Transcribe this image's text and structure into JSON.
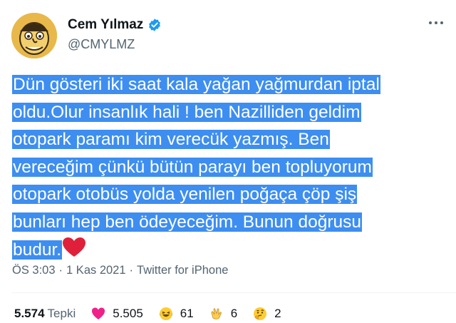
{
  "user": {
    "display_name": "Cem Yılmaz",
    "handle": "@CMYLMZ",
    "avatar_icon": "cartoon-face-avatar",
    "verified_color": "#1d9bf0"
  },
  "tweet": {
    "lines": [
      "Dün gösteri iki saat kala yağan yağmurdan iptal",
      "oldu.Olur insanlık hali ! ben Nazilliden geldim",
      "otopark paramı kim verecük yazmış. Ben",
      "vereceğim çünkü bütün parayı ben topluyorum",
      "otopark otobüs yolda yenilen poğaça çöp şiş",
      "bunları hep ben ödeyeceğim. Bunun doğrusu",
      "budur."
    ],
    "trailing_emoji": "red-heart-emoji",
    "highlight_color": "#3d8ef0"
  },
  "meta": {
    "time": "ÖS 3:03",
    "sep1": "·",
    "date": "1 Kas 2021",
    "sep2": "·",
    "source": "Twitter for iPhone"
  },
  "reactions": {
    "total_count": "5.574",
    "total_label": "Tepki",
    "items": [
      {
        "icon": "heart-emoji",
        "count": "5.505"
      },
      {
        "icon": "laughing-emoji",
        "count": "61"
      },
      {
        "icon": "clapping-hands-emoji",
        "count": "6"
      },
      {
        "icon": "thinking-face-emoji",
        "count": "2"
      }
    ]
  }
}
